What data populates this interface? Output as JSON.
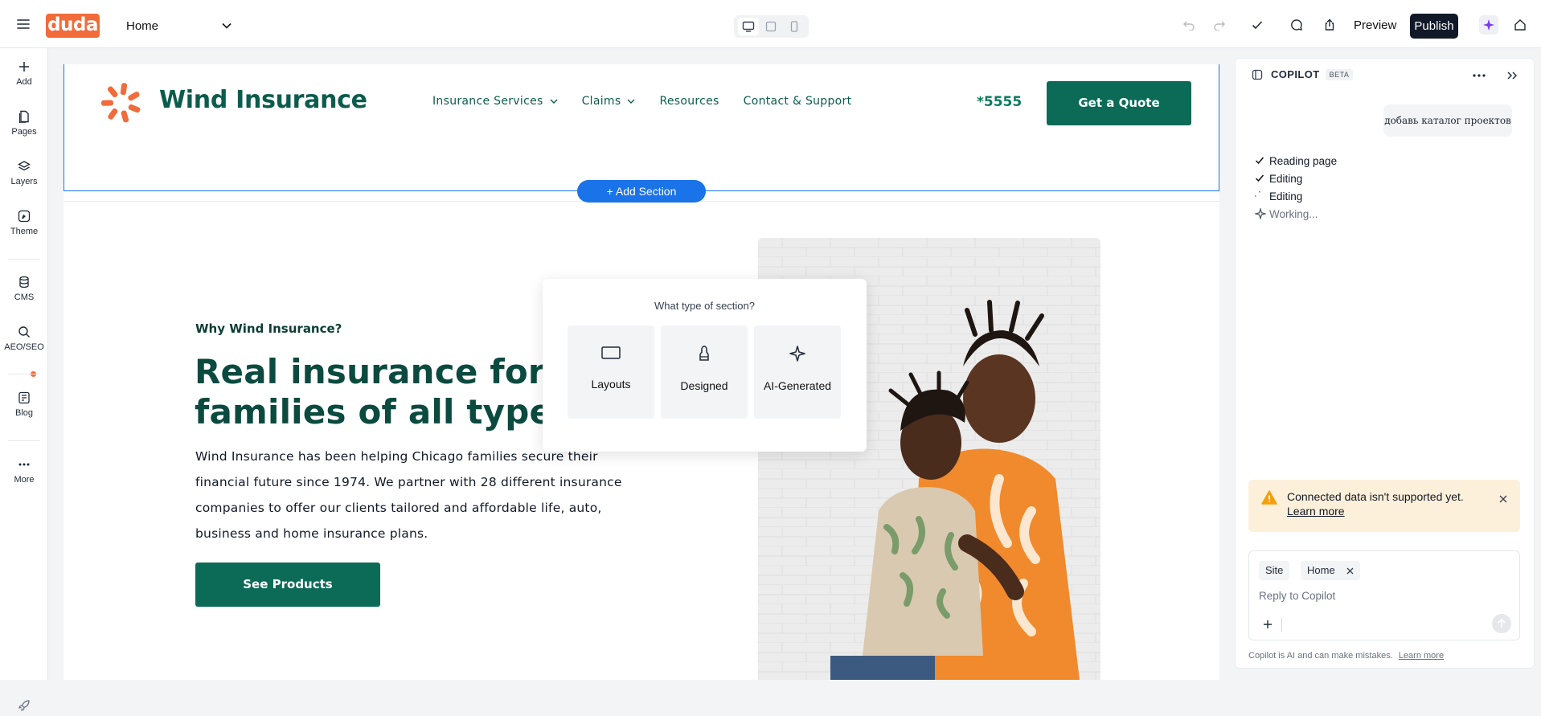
{
  "topbar": {
    "logo": "duda",
    "page_select": "Home",
    "preview": "Preview",
    "publish": "Publish",
    "devices": [
      "desktop-icon",
      "tablet-icon",
      "mobile-icon"
    ],
    "icons": [
      "undo-icon",
      "redo-icon",
      "check-icon",
      "comment-icon",
      "share-icon",
      "ai-sparkle-icon",
      "home-icon"
    ],
    "colors": {
      "logo_bg": "#f26b3a",
      "publish_bg": "#111827",
      "accent": "#1a73e8"
    }
  },
  "sidebar": {
    "items": [
      {
        "label": "Add",
        "icon": "plus-icon"
      },
      {
        "label": "Pages",
        "icon": "pages-icon"
      },
      {
        "label": "Layers",
        "icon": "layers-icon"
      },
      {
        "label": "Theme",
        "icon": "theme-icon"
      },
      {
        "label": "CMS",
        "icon": "database-icon"
      },
      {
        "label": "AEO/SEO",
        "icon": "search-icon"
      },
      {
        "label": "Blog",
        "icon": "blog-icon"
      },
      {
        "label": "More",
        "icon": "more-icon"
      }
    ]
  },
  "site": {
    "name": "Wind Insurance",
    "nav": [
      "Insurance Services",
      "Claims",
      "Resources",
      "Contact & Support"
    ],
    "phone": "*5555",
    "cta": "Get a Quote",
    "add_section": "+ Add Section",
    "hero": {
      "eyebrow": "Why Wind Insurance?",
      "title": "Real insurance for families of all types.",
      "body": "Wind Insurance has been helping Chicago families secure their financial future since 1974. We partner with 28 different insurance companies to offer our clients tailored and affordable life, auto, business and home insurance plans.",
      "button": "See Products"
    },
    "colors": {
      "brand_green": "#0b6b57",
      "brand_orange": "#f26b3a"
    }
  },
  "popup": {
    "title": "What type of section?",
    "options": [
      {
        "label": "Layouts",
        "icon": "layout-icon"
      },
      {
        "label": "Designed",
        "icon": "paint-brush-icon"
      },
      {
        "label": "AI-Generated",
        "icon": "sparkle-icon"
      }
    ]
  },
  "copilot": {
    "title": "COPILOT",
    "badge": "BETA",
    "user_message": "добавь каталог проектов",
    "steps": [
      {
        "label": "Reading page",
        "status": "done"
      },
      {
        "label": "Editing",
        "status": "done"
      },
      {
        "label": "Editing",
        "status": "in-progress"
      },
      {
        "label": "Working...",
        "status": "working"
      }
    ],
    "warning": {
      "text": "Connected data isn't supported yet.",
      "link": "Learn more"
    },
    "chips": [
      "Site",
      "Home"
    ],
    "placeholder": "Reply to Copilot",
    "disclaimer": "Copilot is AI and can make mistakes.",
    "disclaimer_link": "Learn more",
    "colors": {
      "warning_bg": "#fdf0da",
      "warning_icon": "#f59e0b"
    }
  }
}
